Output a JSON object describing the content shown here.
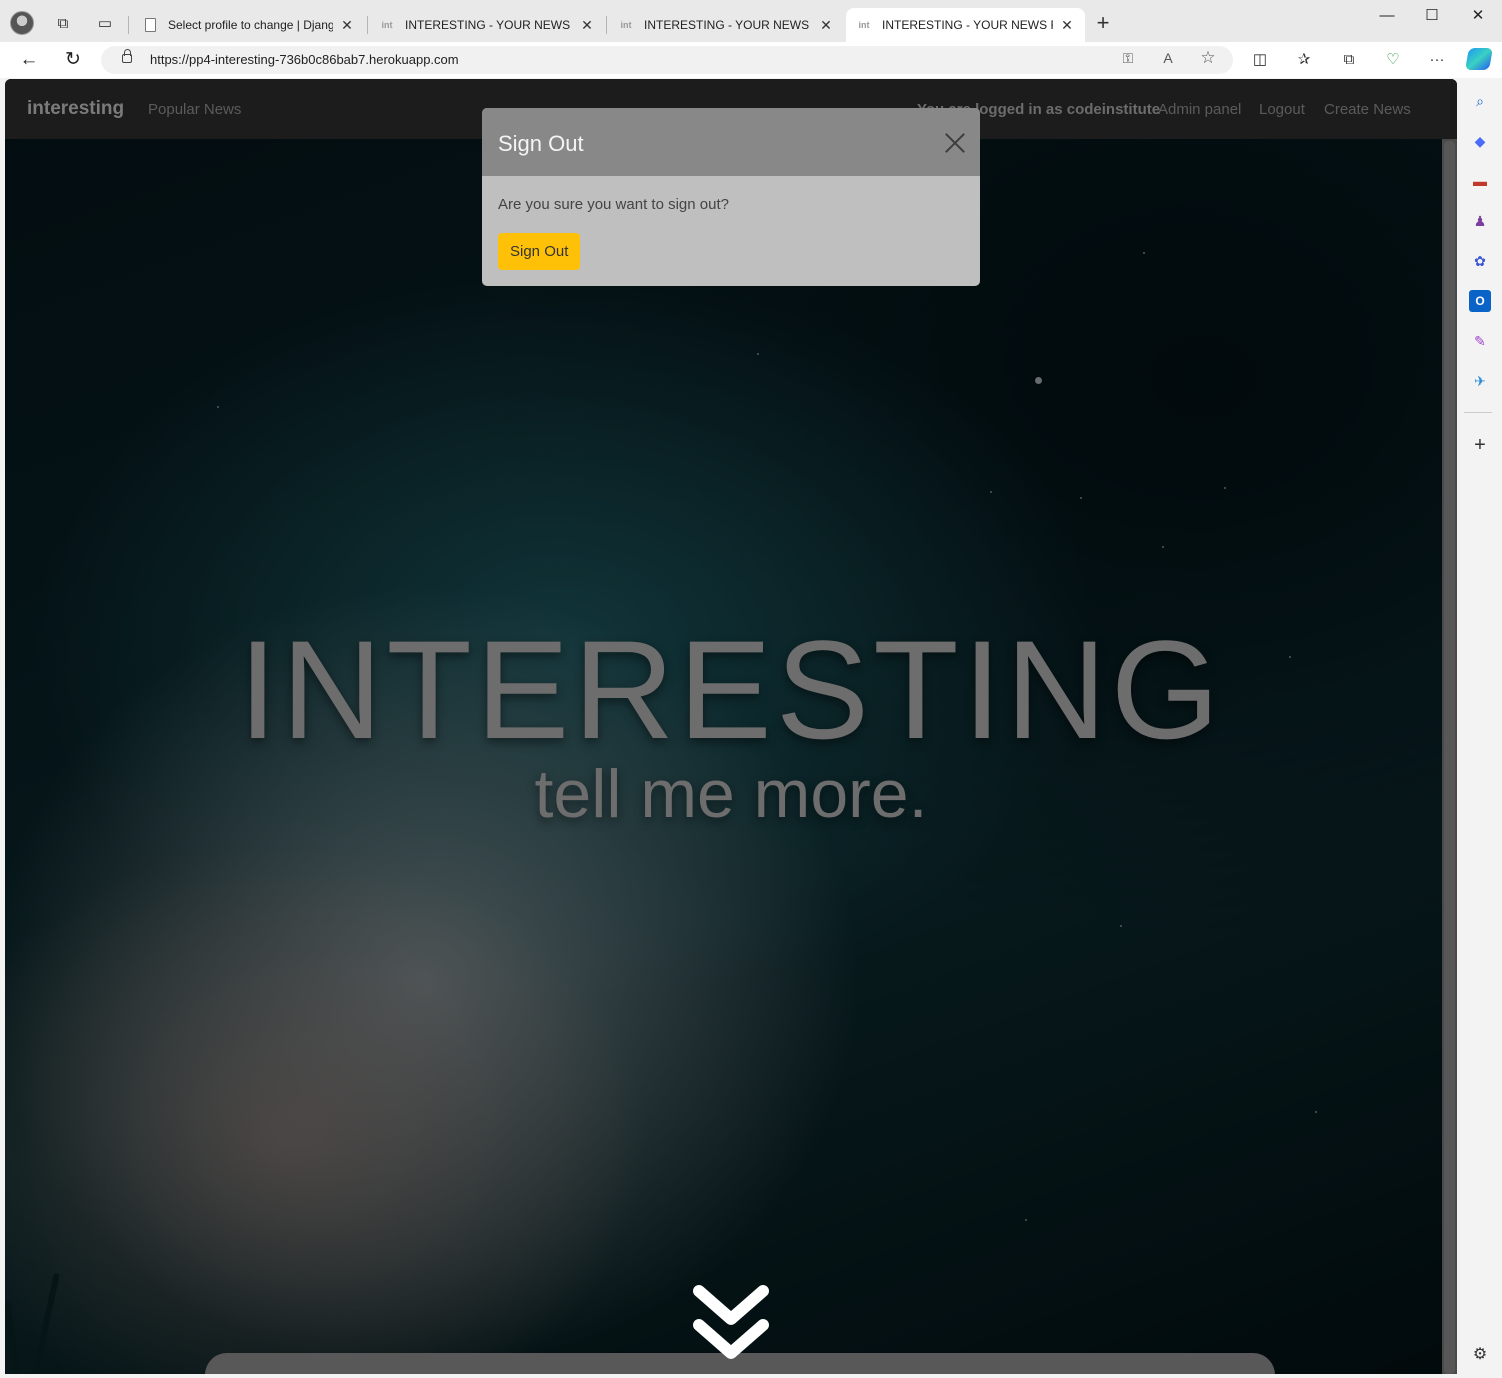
{
  "browser": {
    "tabs": [
      {
        "title": "Select profile to change | Django",
        "favicon": "page-icon",
        "active": false
      },
      {
        "title": "INTERESTING - YOUR NEWS FIX",
        "favicon": "int-logo-icon",
        "active": false
      },
      {
        "title": "INTERESTING - YOUR NEWS FIX",
        "favicon": "int-logo-icon",
        "active": false
      },
      {
        "title": "INTERESTING - YOUR NEWS FIX",
        "favicon": "int-logo-icon",
        "active": true
      }
    ],
    "url": "https://pp4-interesting-736b0c86bab7.herokuapp.com",
    "favicon_text": "int",
    "close_glyph": "✕",
    "new_tab_glyph": "+",
    "window_controls": {
      "minimize": "—",
      "maximize": "☐",
      "close": "✕"
    },
    "nav": {
      "back": "←",
      "refresh": "↻"
    },
    "address_icons": {
      "key": "⚿",
      "read_aloud": "A",
      "favorite": "☆"
    },
    "toolbar_icons": {
      "split": "◫",
      "favorites": "✰",
      "collections": "⧉",
      "health": "♡",
      "more": "···"
    },
    "sidebar_icons": [
      "⌕",
      "◆",
      "▬",
      "♟",
      "✿",
      "O",
      "✎",
      "✈",
      "+",
      "⚙"
    ]
  },
  "site": {
    "brand": "interesting",
    "nav_left": [
      "Popular News"
    ],
    "logged_in_text": "You are logged in as codeinstitute",
    "nav_right": [
      "Admin panel",
      "Logout",
      "Create News"
    ],
    "hero_title": "INTERESTING",
    "hero_subtitle": "tell me more."
  },
  "modal": {
    "title": "Sign Out",
    "body": "Are you sure you want to sign out?",
    "button": "Sign Out"
  },
  "colors": {
    "accent_button": "#ffc107",
    "modal_header": "#888888",
    "modal_body": "#bfbfbf",
    "navbar": "#1c1c1c"
  }
}
